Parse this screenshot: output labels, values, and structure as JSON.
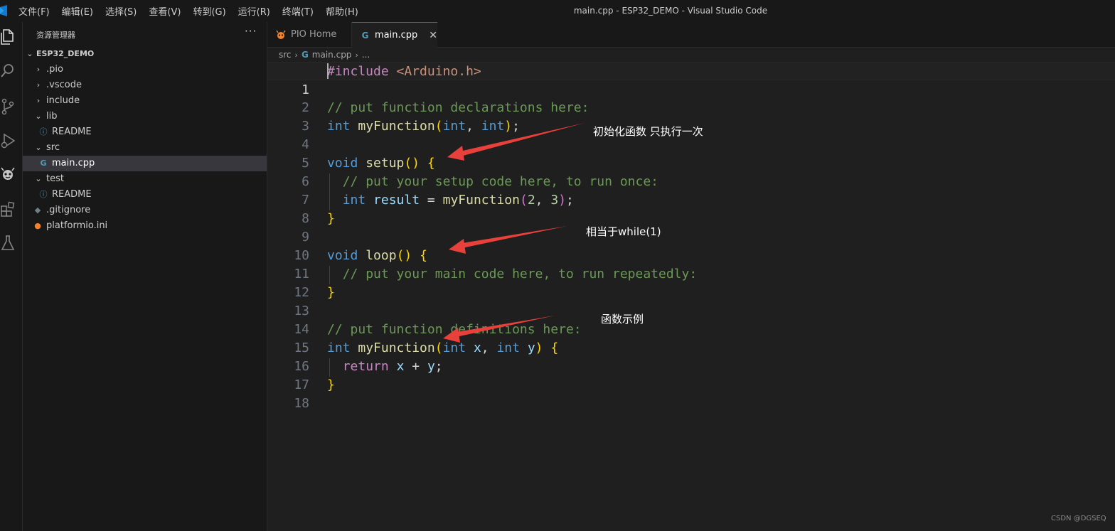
{
  "window": {
    "title": "main.cpp - ESP32_DEMO - Visual Studio Code"
  },
  "menu": [
    "文件(F)",
    "编辑(E)",
    "选择(S)",
    "查看(V)",
    "转到(G)",
    "运行(R)",
    "终端(T)",
    "帮助(H)"
  ],
  "activity_bar": [
    "files-icon",
    "search-icon",
    "source-control-icon",
    "run-debug-icon",
    "platformio-icon",
    "extensions-icon",
    "testing-icon"
  ],
  "sidebar": {
    "title": "资源管理器",
    "more": "···",
    "root": "ESP32_DEMO",
    "items": [
      {
        "label": ".pio"
      },
      {
        "label": ".vscode"
      },
      {
        "label": "include"
      },
      {
        "label": "lib"
      },
      {
        "label": "README"
      },
      {
        "label": "src"
      },
      {
        "label": "main.cpp"
      },
      {
        "label": "test"
      },
      {
        "label": "README"
      },
      {
        "label": ".gitignore"
      },
      {
        "label": "platformio.ini"
      }
    ]
  },
  "tabs": [
    {
      "label": "PIO Home"
    },
    {
      "label": "main.cpp",
      "close": "✕"
    }
  ],
  "breadcrumb": {
    "folder": "src",
    "file": "main.cpp",
    "more": "..."
  },
  "code": {
    "line_numbers": [
      "1",
      "2",
      "3",
      "4",
      "5",
      "6",
      "7",
      "8",
      "9",
      "10",
      "11",
      "12",
      "13",
      "14",
      "15",
      "16",
      "17",
      "18"
    ],
    "text": {
      "include_kw": "#include",
      "include_file": "<Arduino.h>",
      "comment_decl": "// put function declarations here:",
      "int": "int",
      "myFunction": "myFunction",
      "void": "void",
      "setup": "setup",
      "comment_setup": "// put your setup code here, to run once:",
      "result": "result",
      "num2": "2",
      "num3": "3",
      "loop": "loop",
      "comment_loop": "// put your main code here, to run repeatedly:",
      "comment_def": "// put function definitions here:",
      "x": "x",
      "y": "y",
      "return": "return"
    }
  },
  "annotations": {
    "setup_note": "初始化函数 只执行一次",
    "loop_note": "相当于while(1)",
    "function_note": "函数示例"
  },
  "watermark": "CSDN @DGSEQ",
  "colors": {
    "editor_bg": "#1f1f1f",
    "sidebar_bg": "#181818",
    "accent": "#0078d4",
    "arrow": "#e8403a",
    "platformio": "#f5822a",
    "cpp_icon": "#519aba"
  }
}
